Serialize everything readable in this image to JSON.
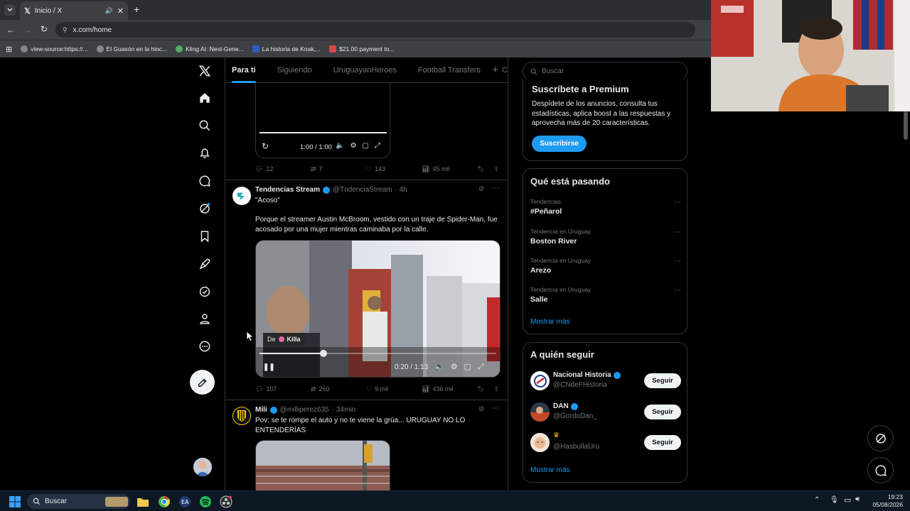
{
  "browser": {
    "tab_title": "Inicio / X",
    "url": "x.com/home",
    "bookmarks": [
      "view-source:https://...",
      "El Guasón en la hinc...",
      "Kling AI: Next-Gene...",
      "La historia de Knak,...",
      "$21.00 payment to..."
    ]
  },
  "nav": {
    "icons": [
      "x-logo-icon",
      "home-icon",
      "search-icon",
      "notifications-icon",
      "messages-icon",
      "grok-icon",
      "bookmarks-icon",
      "rocket-icon",
      "verified-icon",
      "profile-icon",
      "more-icon",
      "compose-icon"
    ]
  },
  "timeline": {
    "tabs": [
      "Para ti",
      "Siguiendo",
      "UruguayanHeroes",
      "Football Transfers",
      "Cosc"
    ],
    "post0": {
      "video_time": "1:00 / 1:00",
      "replies": "12",
      "reposts": "7",
      "likes": "143",
      "views": "45 mil"
    },
    "post1": {
      "name": "Tendencias Stream",
      "handle": "@TndenciaStream",
      "time": "· 4h",
      "text1": "\"Acoso\"",
      "text2": "Porque el streamer Austin McBroom, vestido con un traje de Spider-Man, fue acosado por una mujer mientras caminaba por la calle.",
      "video_badge_prefix": "De",
      "video_badge_name": "Killa",
      "video_time": "0:20 / 1:13",
      "video_progress": 0.27,
      "replies": "107",
      "reposts": "260",
      "likes": "9 mil",
      "views": "436 mil"
    },
    "post2": {
      "name": "Mili",
      "handle": "@milliperez635",
      "time": "· 34min",
      "text": "Pov: se te rompe el auto y no te viene la grúa... URUGUAY NO LO ENTENDERÍAS"
    }
  },
  "sidebar": {
    "search_placeholder": "Buscar",
    "premium": {
      "title": "Suscríbete a Premium",
      "body": "Despídete de los anuncios, consulta tus estadísticas, aplica boost a las respuestas y aprovecha más de 20 características.",
      "button": "Suscribirse"
    },
    "trends": {
      "title": "Qué está pasando",
      "items": [
        {
          "context": "Tendencias",
          "name": "#Peñarol"
        },
        {
          "context": "Tendencia en Uruguay",
          "name": "Boston River"
        },
        {
          "context": "Tendencia en Uruguay",
          "name": "Arezo"
        },
        {
          "context": "Tendencia en Uruguay",
          "name": "Salle"
        }
      ],
      "more": "Mostrar más"
    },
    "follow": {
      "title": "A quién seguir",
      "items": [
        {
          "name": "Nacional Historia",
          "handle": "@CNdeFHistoria",
          "button": "Seguir"
        },
        {
          "name": "DAN",
          "handle": "@GordoDan_",
          "button": "Seguir"
        },
        {
          "name": "",
          "handle": "@HasbullaUru",
          "button": "Seguir"
        }
      ],
      "more": "Mostrar más"
    }
  },
  "taskbar": {
    "search": "Buscar",
    "time": "19:23",
    "date": "05/08/2026"
  },
  "colors": {
    "accent": "#1d9bf0",
    "background": "#000000",
    "border": "#2f3336",
    "muted": "#71767b"
  }
}
